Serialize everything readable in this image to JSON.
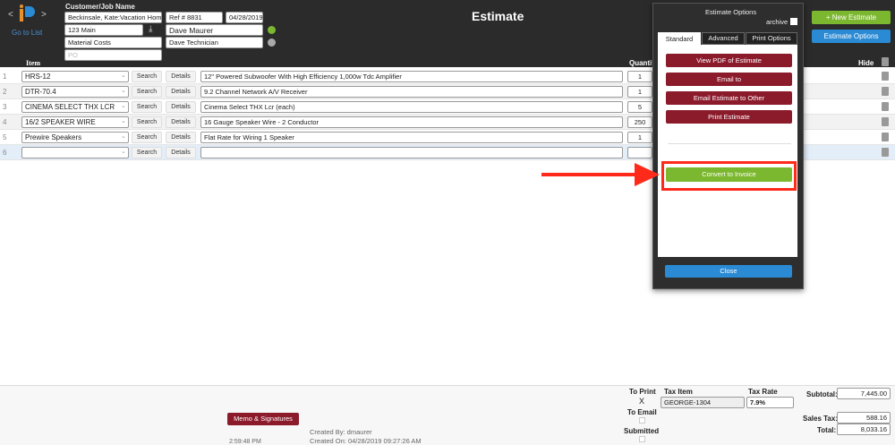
{
  "header": {
    "title": "Estimate",
    "nav_prev": "<",
    "nav_next": ">",
    "go_to_list": "Go to List",
    "customer_label": "Customer/Job Name",
    "customer": "Beckinsale, Kate:Vacation Home",
    "ref": "Ref #   8831",
    "date": "04/28/2019",
    "address": "123 Main",
    "rep": "Dave Maurer",
    "class": "Material Costs",
    "technician": "Dave Technician",
    "po_placeholder": "PO"
  },
  "table": {
    "columns": {
      "item": "Item",
      "quantity": "Quantit",
      "hide": "Hide"
    },
    "search_label": "Search",
    "details_label": "Details",
    "rows": [
      {
        "num": "1",
        "item": "HRS-12",
        "desc": "12\" Powered Subwoofer With High Efficiency 1,000w Tdc Amplifier",
        "qty": "1"
      },
      {
        "num": "2",
        "item": "DTR-70.4",
        "desc": "9.2 Channel Network A/V Receiver",
        "qty": "1"
      },
      {
        "num": "3",
        "item": "CINEMA SELECT THX LCR",
        "desc": "Cinema Select THX Lcr (each)",
        "qty": "5"
      },
      {
        "num": "4",
        "item": "16/2 SPEAKER WIRE",
        "desc": "16 Gauge Speaker Wire - 2 Conductor",
        "qty": "250"
      },
      {
        "num": "5",
        "item": "Prewire Speakers",
        "desc": "Flat Rate for Wiring 1 Speaker",
        "qty": "1"
      },
      {
        "num": "6",
        "item": "",
        "desc": "",
        "qty": ""
      }
    ]
  },
  "right_buttons": {
    "new_estimate": "+ New Estimate",
    "estimate_options": "Estimate Options"
  },
  "dialog": {
    "title": "Estimate Options",
    "archive": "archive",
    "tabs": [
      "Standard",
      "Advanced",
      "Print Options"
    ],
    "actions": [
      "View PDF of Estimate",
      "Email to",
      "Email Estimate to Other",
      "Print Estimate"
    ],
    "convert": "Convert to Invoice",
    "close": "Close"
  },
  "footer": {
    "memo": "Memo & Signatures",
    "time": "2:59:48 PM",
    "created_by": "Created By: dmaurer",
    "created_on": "Created On: 04/28/2019 09:27:26 AM",
    "to_print": "To Print",
    "to_print_mark": "X",
    "to_email": "To Email",
    "submitted": "Submitted",
    "tax_item_label": "Tax Item",
    "tax_item": "GEORGE-1304",
    "tax_rate_label": "Tax Rate",
    "tax_rate": "7.9%",
    "subtotal_label": "Subtotal:",
    "subtotal": "7,445.00",
    "sales_tax_label": "Sales Tax:",
    "sales_tax": "588.16",
    "total_label": "Total:",
    "total": "8,033.16"
  },
  "colors": {
    "header": "#2b2b2b",
    "maroon": "#8b1a2b",
    "green": "#7cb82f",
    "blue": "#2a8ad4",
    "highlight": "#ff2a1a"
  }
}
